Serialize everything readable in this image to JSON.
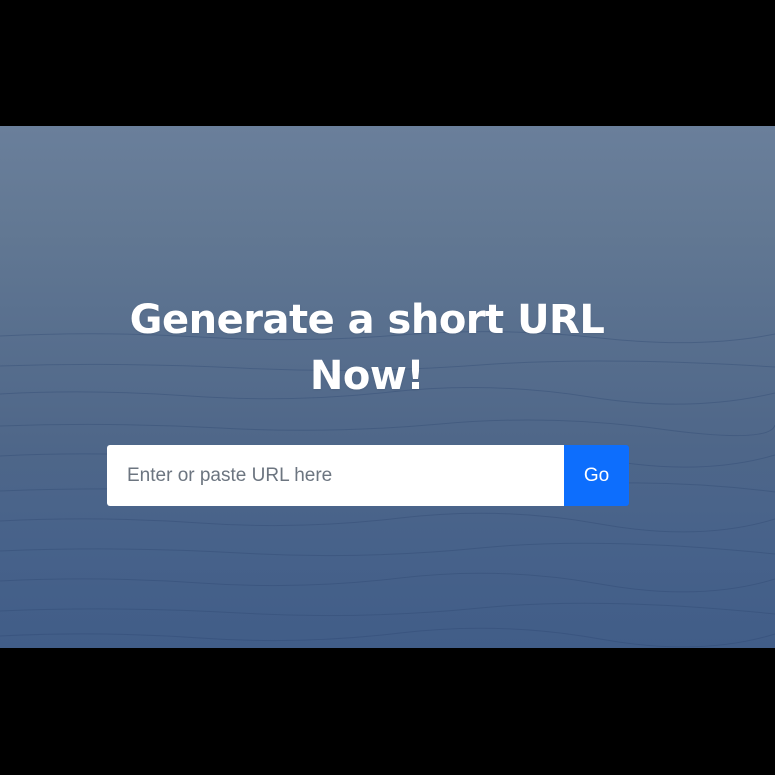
{
  "hero": {
    "headline": "Generate a short URL Now!"
  },
  "form": {
    "placeholder": "Enter or paste URL here",
    "value": "",
    "submit_label": "Go"
  },
  "colors": {
    "background": "#000000",
    "hero_top": "#6a7f9b",
    "hero_bottom": "#415d88",
    "button": "#0d6efd",
    "headline": "#ffffff"
  }
}
